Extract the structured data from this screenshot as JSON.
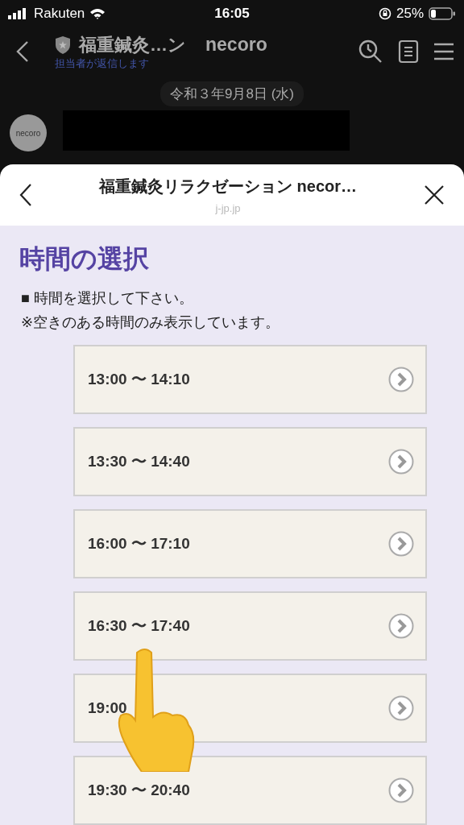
{
  "status_bar": {
    "carrier": "Rakuten",
    "time": "16:05",
    "battery": "25%"
  },
  "chat_header": {
    "title": "福重鍼灸…ン",
    "account": "necoro",
    "subtitle": "担当者が返信します"
  },
  "chat": {
    "date": "令和３年9月8日 (水)",
    "avatar_text": "necoro"
  },
  "sheet": {
    "title": "福重鍼灸リラクゼーション necor…",
    "domain": "j-jp.jp"
  },
  "page": {
    "heading": "時間の選択",
    "notes": [
      "■ 時間を選択して下さい。",
      "※空きのある時間のみ表示しています。"
    ]
  },
  "slots": [
    {
      "label": "13:00 〜 14:10"
    },
    {
      "label": "13:30 〜 14:40"
    },
    {
      "label": "16:00 〜 17:10"
    },
    {
      "label": "16:30 〜 17:40"
    },
    {
      "label": "19:00"
    },
    {
      "label": "19:30 〜 20:40"
    }
  ]
}
